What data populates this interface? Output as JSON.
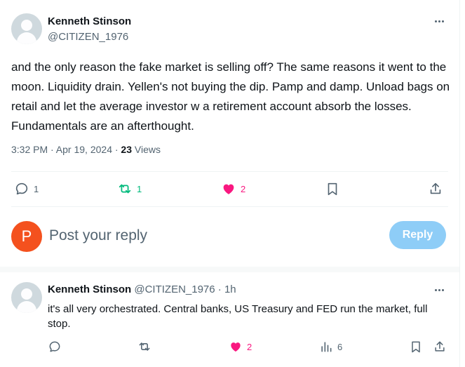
{
  "tweet": {
    "author_name": "Kenneth Stinson",
    "author_handle": "@CITIZEN_1976",
    "text": "and the only reason the fake market is selling off? The same reasons it went to the moon. Liquidity drain. Yellen's not buying the dip. Pamp and damp. Unload bags on retail and let the average investor w a retirement account absorb the losses. Fundamentals are an afterthought.",
    "timestamp": "3:32 PM · Apr 19, 2024 · ",
    "views_count": "23",
    "views_label": " Views",
    "replies": "1",
    "retweets": "1",
    "likes": "2"
  },
  "composer": {
    "avatar_letter": "P",
    "placeholder": "Post your reply",
    "reply_label": "Reply"
  },
  "reply": {
    "author_name": "Kenneth Stinson",
    "author_handle": "@CITIZEN_1976 · 1h",
    "text": "it's all very orchestrated. Central banks, US Treasury  and FED run the market, full stop.",
    "likes": "2",
    "views": "6"
  },
  "colors": {
    "retweet_green": "#00ba7c",
    "like_pink": "#f91880",
    "reply_button": "#8ecdf7",
    "composer_avatar": "#f4511e"
  }
}
